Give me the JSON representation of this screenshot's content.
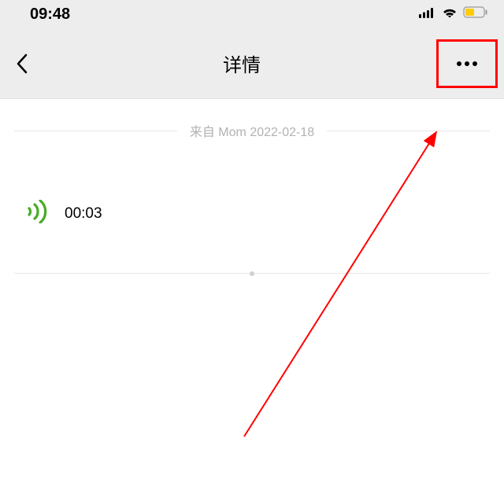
{
  "status": {
    "time": "09:48"
  },
  "nav": {
    "title": "详情"
  },
  "detail": {
    "source_prefix": "来自 ",
    "source_name": "Mom",
    "source_date": "2022-02-18",
    "voice_duration": "00:03"
  }
}
